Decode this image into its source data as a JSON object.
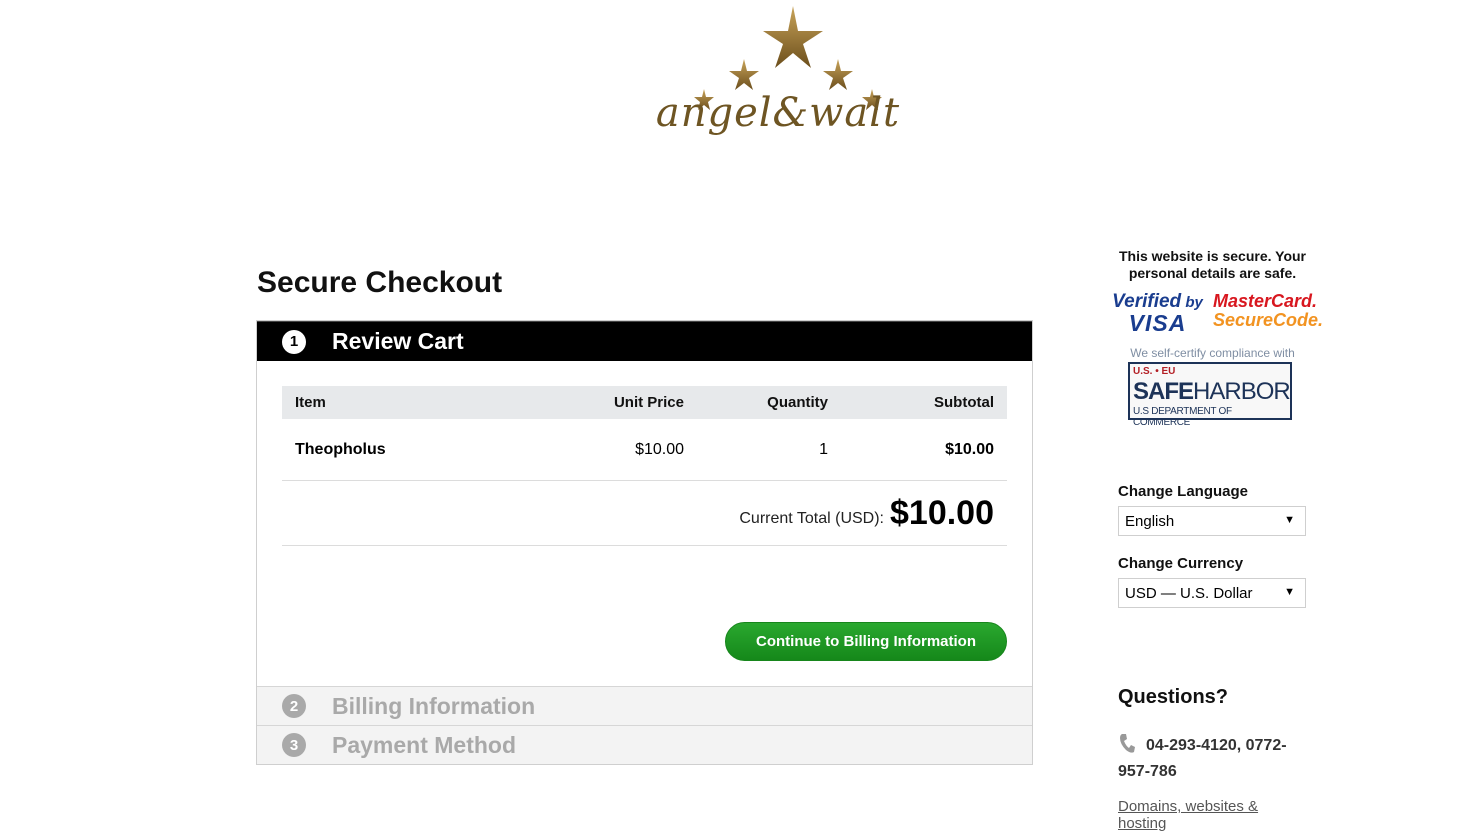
{
  "brand": {
    "logo_text": "angel&walt",
    "logo_color": "#6e5523"
  },
  "page": {
    "title": "Secure Checkout"
  },
  "steps": [
    {
      "number": "1",
      "label": "Review Cart",
      "state": "active"
    },
    {
      "number": "2",
      "label": "Billing Information",
      "state": "inactive"
    },
    {
      "number": "3",
      "label": "Payment Method",
      "state": "inactive"
    }
  ],
  "cart": {
    "headers": {
      "item": "Item",
      "unit_price": "Unit Price",
      "quantity": "Quantity",
      "subtotal": "Subtotal"
    },
    "rows": [
      {
        "item": "Theopholus",
        "unit_price": "$10.00",
        "quantity": "1",
        "subtotal": "$10.00"
      }
    ],
    "total_label": "Current Total (USD):",
    "total_value": "$10.00",
    "continue_label": "Continue to Billing Information"
  },
  "sidebar": {
    "secure_note": "This website is secure. Your personal details are safe.",
    "visa": {
      "line1": "Verified",
      "by": "by",
      "line2": "VISA"
    },
    "mastercard": {
      "line1": "MasterCard.",
      "line2": "SecureCode."
    },
    "safeharbor_note": "We self-certify compliance with",
    "safeharbor": {
      "top": "U.S. • EU",
      "main_bold": "SAFE",
      "main_rest": "HARBOR",
      "bottom": "U.S DEPARTMENT OF COMMERCE"
    },
    "language": {
      "label": "Change Language",
      "selected": "English"
    },
    "currency": {
      "label": "Change Currency",
      "selected": "USD — U.S. Dollar"
    },
    "questions": {
      "title": "Questions?",
      "phone": "04-293-4120, 0772-957-786",
      "link": "Domains, websites & hosting"
    }
  },
  "colors": {
    "accent_green": "#1f9a25",
    "header_black": "#000000",
    "inactive_gray": "#a9a9a9"
  }
}
